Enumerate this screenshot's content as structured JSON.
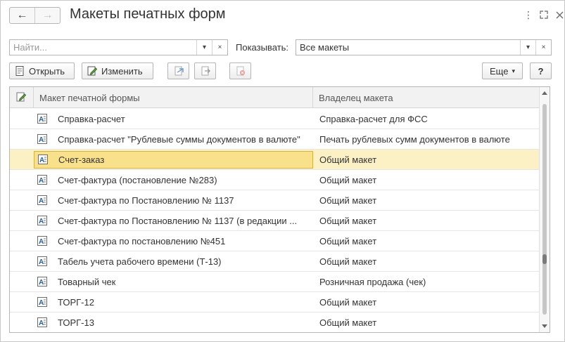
{
  "window": {
    "title": "Макеты печатных форм",
    "nav_back": "←",
    "nav_forward": "→",
    "more_icon": "⋮",
    "expand_icon": "⛶",
    "close_icon": "✕"
  },
  "filter": {
    "search_placeholder": "Найти...",
    "show_label": "Показывать:",
    "show_value": "Все макеты",
    "dropdown_glyph": "▾",
    "clear_glyph": "×"
  },
  "toolbar": {
    "open_label": "Открыть",
    "edit_label": "Изменить",
    "more_label": "Еще",
    "more_glyph": "▾",
    "help_label": "?"
  },
  "table": {
    "columns": {
      "name": "Макет печатной формы",
      "owner": "Владелец макета"
    },
    "rows": [
      {
        "name": "Справка-расчет",
        "owner": "Справка-расчет для ФСС"
      },
      {
        "name": "Справка-расчет \"Рублевые суммы документов в валюте\"",
        "owner": "Печать рублевых сумм документов в валюте"
      },
      {
        "name": "Счет-заказ",
        "owner": "Общий макет"
      },
      {
        "name": "Счет-фактура (постановление №283)",
        "owner": "Общий макет"
      },
      {
        "name": "Счет-фактура по Постановлению № 1137",
        "owner": "Общий макет"
      },
      {
        "name": "Счет-фактура по Постановлению № 1137 (в редакции ...",
        "owner": "Общий макет"
      },
      {
        "name": "Счет-фактура по постановлению №451",
        "owner": "Общий макет"
      },
      {
        "name": "Табель учета рабочего времени (Т-13)",
        "owner": "Общий макет"
      },
      {
        "name": "Товарный чек",
        "owner": "Розничная продажа (чек)"
      },
      {
        "name": "ТОРГ-12",
        "owner": "Общий макет"
      },
      {
        "name": "ТОРГ-13",
        "owner": "Общий макет"
      }
    ],
    "selected_index": 2
  },
  "colors": {
    "selected_row": "#fbf1c5",
    "selected_cell": "#f9e08a"
  }
}
